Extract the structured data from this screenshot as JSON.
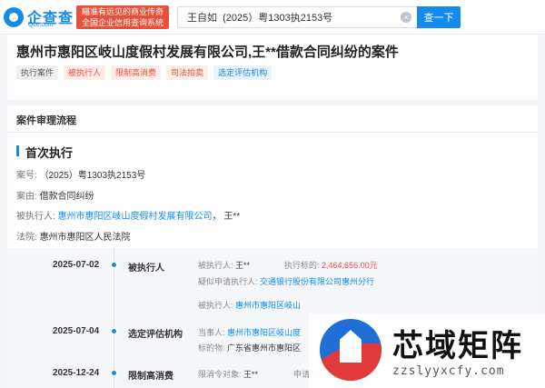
{
  "header": {
    "logo_text": "企查查",
    "logo_sub": "Qcc.com",
    "slogan_line1": "瞄准有远见的商业传奇",
    "slogan_line2": "全国企业信用查询系统",
    "search_value": "王自如  (2025）粤1303执2153号",
    "search_button": "查一下"
  },
  "case": {
    "title": "惠州市惠阳区岐山度假村发展有限公司,王**借款合同纠纷的案件",
    "tags": [
      "执行案件",
      "被执行人",
      "限制高消费",
      "司法拍卖",
      "选定评估机构"
    ]
  },
  "process": {
    "heading": "案件审理流程",
    "section": "首次执行",
    "case_no_label": "案号:",
    "case_no": "（2025）粤1303执2153号",
    "cause_label": "案由:",
    "cause": "借款合同纠纷",
    "executed_label": "被执行人:",
    "executed_company": "惠州市惠阳区岐山度假村发展有限公司",
    "executed_sep": "，",
    "executed_person": "王**",
    "court_label": "法院:",
    "court": "惠州市惠阳区人民法院"
  },
  "timeline": [
    {
      "date": "2025-07-02",
      "type": "被执行人",
      "f1_label": "被执行人:",
      "f1_value": "王**",
      "f2_label": "执行标的:",
      "f2_value": "2,464,656.00元",
      "f3_label": "疑似申请执行人:",
      "f3_value": "交通银行股份有限公司惠州分行"
    },
    {
      "date": "2025-07-04",
      "type": "选定评估机构",
      "f0_label": "被执行人:",
      "f0_value": "惠州市惠阳区岐山",
      "f1_label": "当事人:",
      "f1_value": "惠州市惠阳区岐山度",
      "f2_label": "标的物:",
      "f2_value": "广东省惠州市惠阳区"
    },
    {
      "date": "2025-12-24",
      "type": "限制高消费",
      "f1_label": "限消令对象:",
      "f1_value": "王**",
      "f2_label": "申请人"
    }
  ],
  "watermark": {
    "title": "芯域矩阵",
    "domain": "zzslyyxcfy.com"
  },
  "colors": {
    "brand": "#128bed",
    "alert": "#e8503a"
  }
}
